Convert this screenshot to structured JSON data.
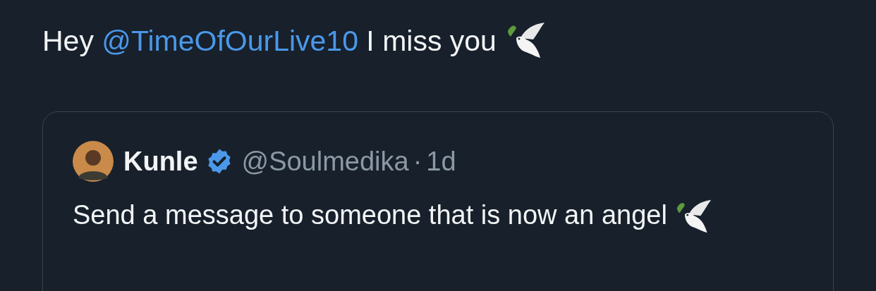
{
  "tweet": {
    "text_parts": [
      {
        "kind": "text",
        "text": "Hey "
      },
      {
        "kind": "mention",
        "text": "@TimeOfOurLive10"
      },
      {
        "kind": "text",
        "text": " I miss you"
      }
    ],
    "quote": {
      "name": "Kunle",
      "verified": true,
      "handle": "@Soulmedika",
      "separator": "·",
      "time": "1d",
      "text": "Send a message to someone that is now an angel"
    }
  }
}
